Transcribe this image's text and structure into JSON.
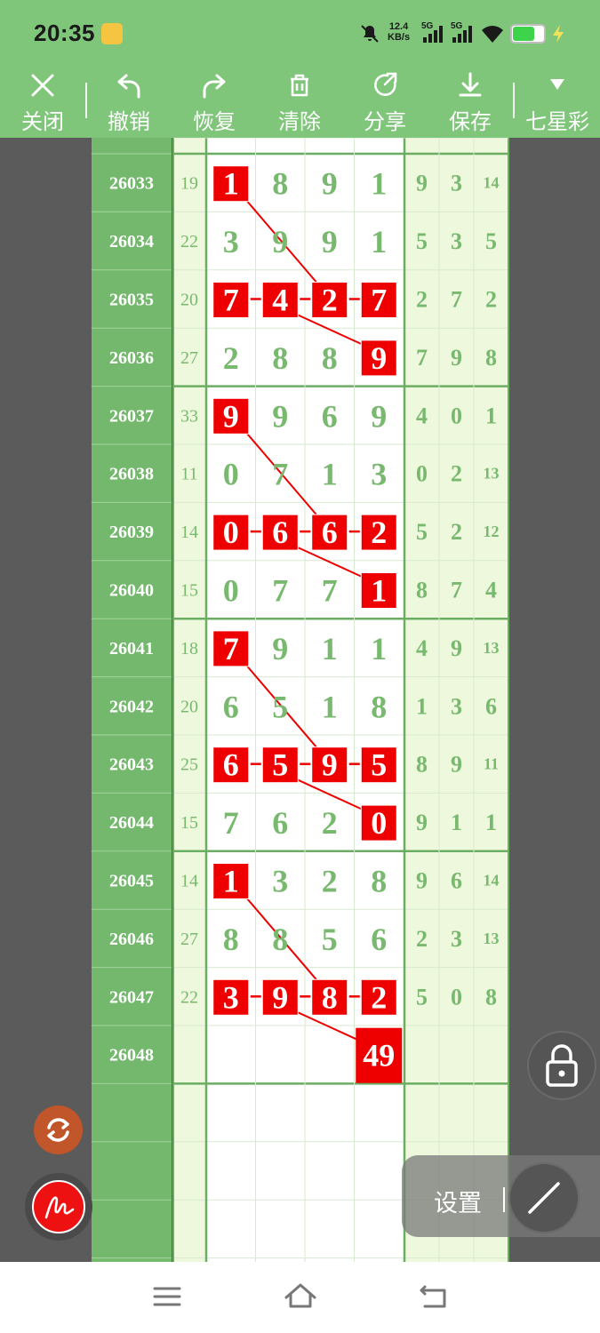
{
  "status": {
    "time": "20:35",
    "net_speed_value": "12.4",
    "net_speed_unit": "KB/s",
    "sim1": "5G",
    "sim2": "5G"
  },
  "toolbar": {
    "close_label": "关闭",
    "undo_label": "撤销",
    "redo_label": "恢复",
    "clear_label": "清除",
    "share_label": "分享",
    "save_label": "保存",
    "lottery_label": "七星彩"
  },
  "rows": [
    {
      "issue": "26033",
      "sum": "19",
      "digits": [
        "1",
        "8",
        "9",
        "1"
      ],
      "right": [
        "9",
        "3",
        "14"
      ],
      "hl": [
        0
      ]
    },
    {
      "issue": "26034",
      "sum": "22",
      "digits": [
        "3",
        "9",
        "9",
        "1"
      ],
      "right": [
        "5",
        "3",
        "5"
      ],
      "hl": []
    },
    {
      "issue": "26035",
      "sum": "20",
      "digits": [
        "7",
        "4",
        "2",
        "7"
      ],
      "right": [
        "2",
        "7",
        "2"
      ],
      "hl": [
        0,
        1,
        2,
        3
      ]
    },
    {
      "issue": "26036",
      "sum": "27",
      "digits": [
        "2",
        "8",
        "8",
        "9"
      ],
      "right": [
        "7",
        "9",
        "8"
      ],
      "hl": [
        3
      ]
    },
    {
      "issue": "26037",
      "sum": "33",
      "digits": [
        "9",
        "9",
        "6",
        "9"
      ],
      "right": [
        "4",
        "0",
        "1"
      ],
      "hl": [
        0
      ]
    },
    {
      "issue": "26038",
      "sum": "11",
      "digits": [
        "0",
        "7",
        "1",
        "3"
      ],
      "right": [
        "0",
        "2",
        "13"
      ],
      "hl": []
    },
    {
      "issue": "26039",
      "sum": "14",
      "digits": [
        "0",
        "6",
        "6",
        "2"
      ],
      "right": [
        "5",
        "2",
        "12"
      ],
      "hl": [
        0,
        1,
        2,
        3
      ]
    },
    {
      "issue": "26040",
      "sum": "15",
      "digits": [
        "0",
        "7",
        "7",
        "1"
      ],
      "right": [
        "8",
        "7",
        "4"
      ],
      "hl": [
        3
      ]
    },
    {
      "issue": "26041",
      "sum": "18",
      "digits": [
        "7",
        "9",
        "1",
        "1"
      ],
      "right": [
        "4",
        "9",
        "13"
      ],
      "hl": [
        0
      ]
    },
    {
      "issue": "26042",
      "sum": "20",
      "digits": [
        "6",
        "5",
        "1",
        "8"
      ],
      "right": [
        "1",
        "3",
        "6"
      ],
      "hl": []
    },
    {
      "issue": "26043",
      "sum": "25",
      "digits": [
        "6",
        "5",
        "9",
        "5"
      ],
      "right": [
        "8",
        "9",
        "11"
      ],
      "hl": [
        0,
        1,
        2,
        3
      ]
    },
    {
      "issue": "26044",
      "sum": "15",
      "digits": [
        "7",
        "6",
        "2",
        "0"
      ],
      "right": [
        "9",
        "1",
        "1"
      ],
      "hl": [
        3
      ]
    },
    {
      "issue": "26045",
      "sum": "14",
      "digits": [
        "1",
        "3",
        "2",
        "8"
      ],
      "right": [
        "9",
        "6",
        "14"
      ],
      "hl": [
        0
      ]
    },
    {
      "issue": "26046",
      "sum": "27",
      "digits": [
        "8",
        "8",
        "5",
        "6"
      ],
      "right": [
        "2",
        "3",
        "13"
      ],
      "hl": []
    },
    {
      "issue": "26047",
      "sum": "22",
      "digits": [
        "3",
        "9",
        "8",
        "2"
      ],
      "right": [
        "5",
        "0",
        "8"
      ],
      "hl": [
        0,
        1,
        2,
        3
      ]
    },
    {
      "issue": "26048",
      "sum": "",
      "digits": [
        "",
        "",
        "",
        ""
      ],
      "right": [
        "",
        "",
        ""
      ],
      "hl": []
    }
  ],
  "prediction": "49",
  "floating": {
    "settings_label": "设置",
    "separator": "|"
  },
  "colors": {
    "header_green": "#7fc67a",
    "issue_column": "#74b86d",
    "light_column": "#eef8dd",
    "digit_green": "#79b96f",
    "highlight_red": "#ee0000"
  }
}
